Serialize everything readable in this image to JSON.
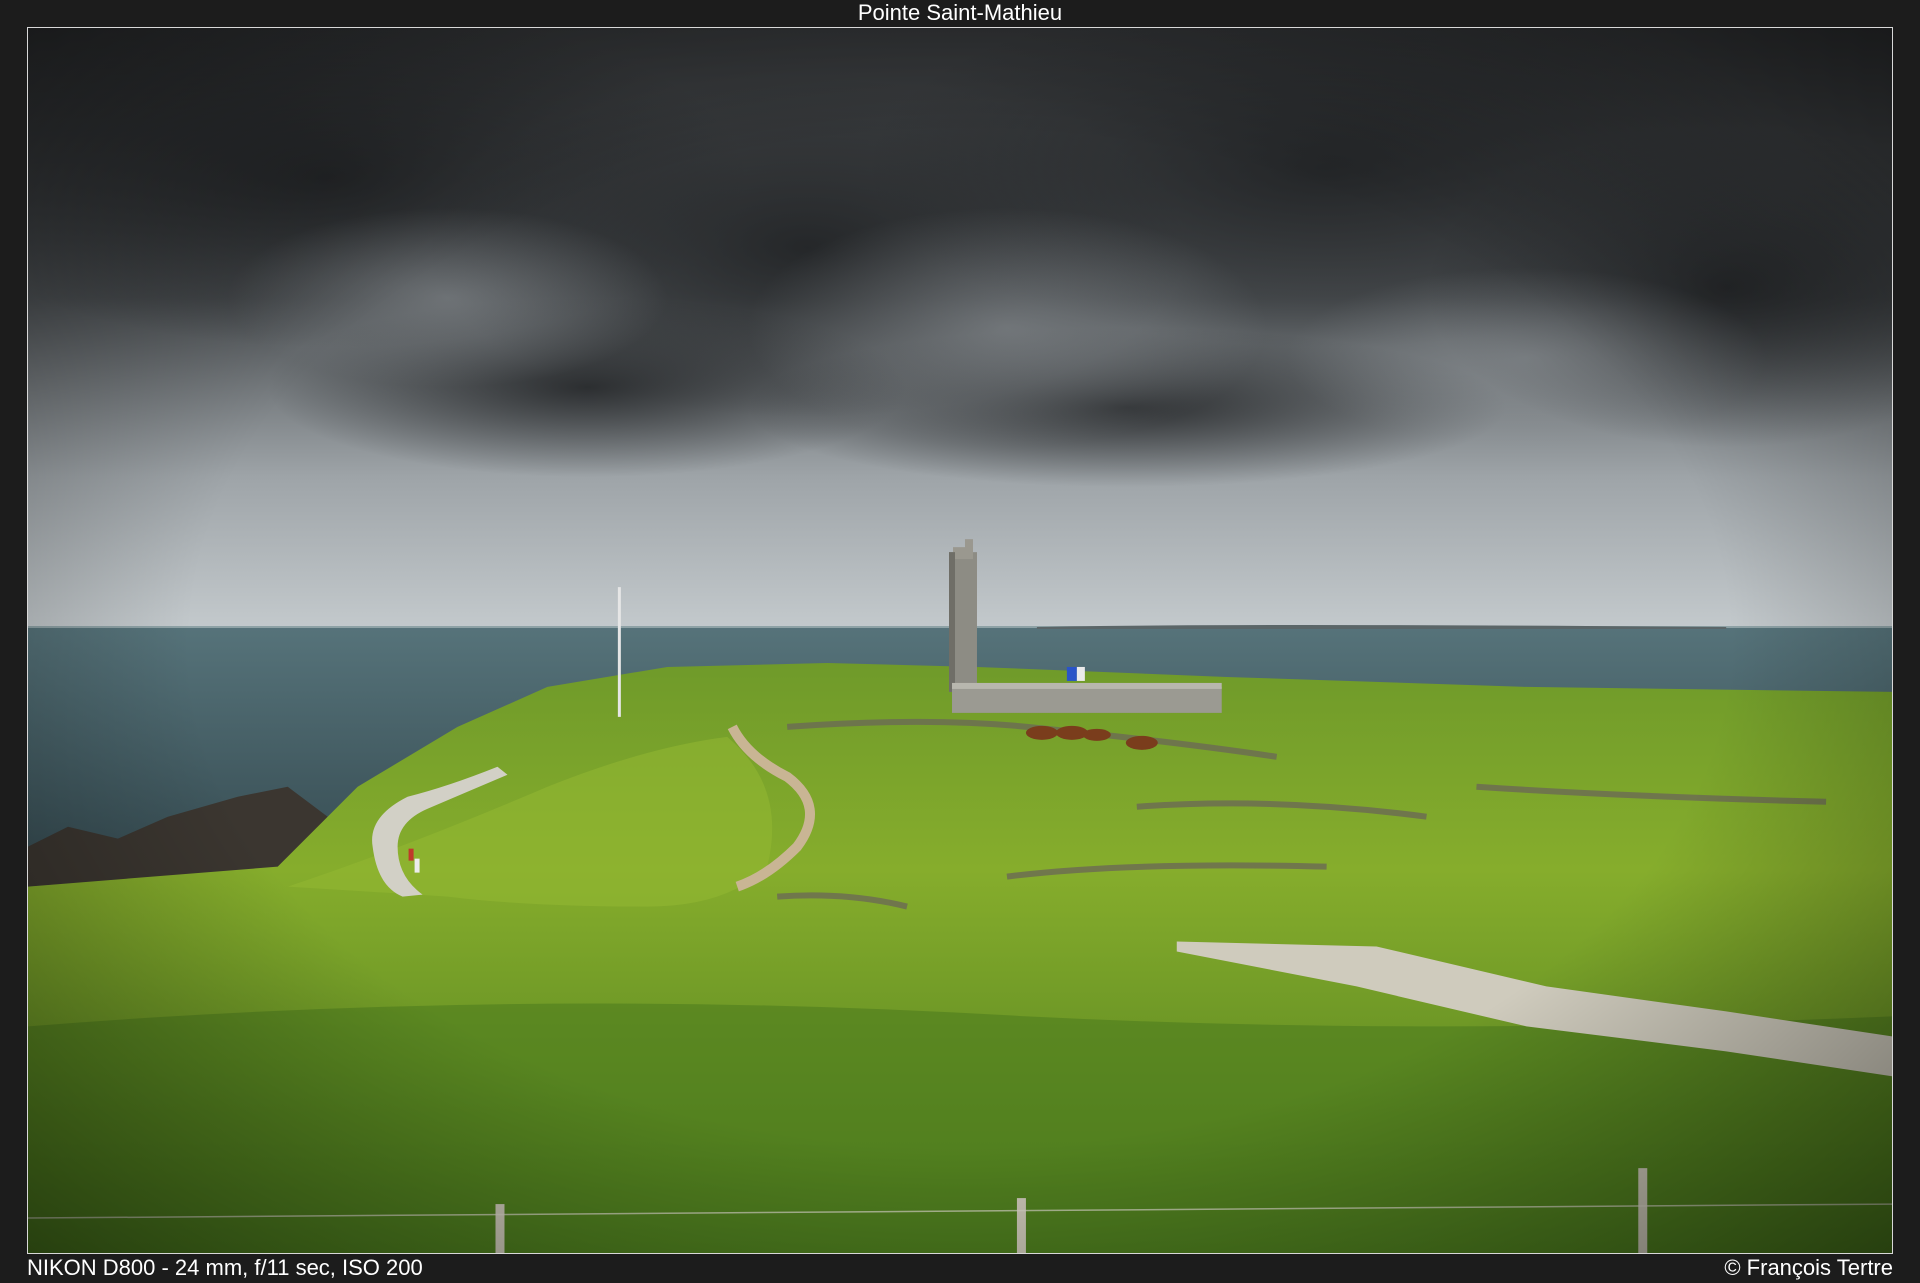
{
  "header": {
    "title": "Pointe Saint-Mathieu"
  },
  "footer": {
    "exif": "NIKON D800 - 24 mm, f/11 sec, ISO 200",
    "credit": "© François Tertre"
  },
  "photo": {
    "subject": "lighthouse-tower-coastline-icon",
    "palette": {
      "sky_dark": "#2e3032",
      "sky_mid": "#5a5e62",
      "sky_light": "#b9bec2",
      "sea": "#3e5a60",
      "grass_bright": "#7ea72a",
      "grass_dark": "#3f6a1c",
      "path": "#cfc2a6",
      "tower": "#8d8c84"
    }
  }
}
